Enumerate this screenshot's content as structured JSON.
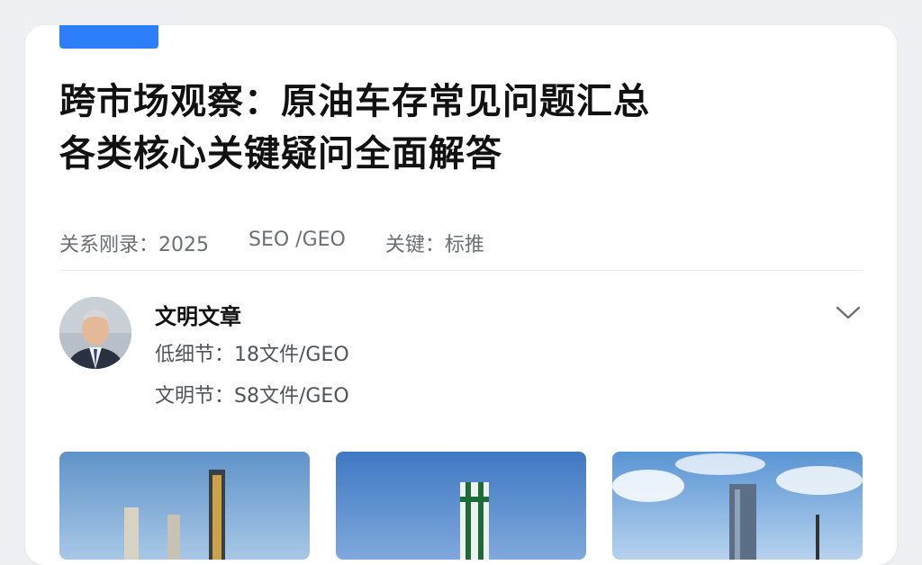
{
  "article": {
    "title_line1": "跨市场观察：原油车存常见问题汇总",
    "title_line2": "各类核心关键疑问全面解答"
  },
  "meta": {
    "date": "关系刚录：2025",
    "category": "SEO /GEO",
    "keyword": "关键：标推"
  },
  "author": {
    "name": "文明文章",
    "line1": "低细节：18文件/GEO",
    "line2": "文明节：S8文件/GEO"
  },
  "icons": {
    "expand": "chevron-down-icon",
    "avatar": "avatar"
  },
  "colors": {
    "accent": "#2d7ff9",
    "text": "#111111",
    "muted": "#6b6f76"
  }
}
